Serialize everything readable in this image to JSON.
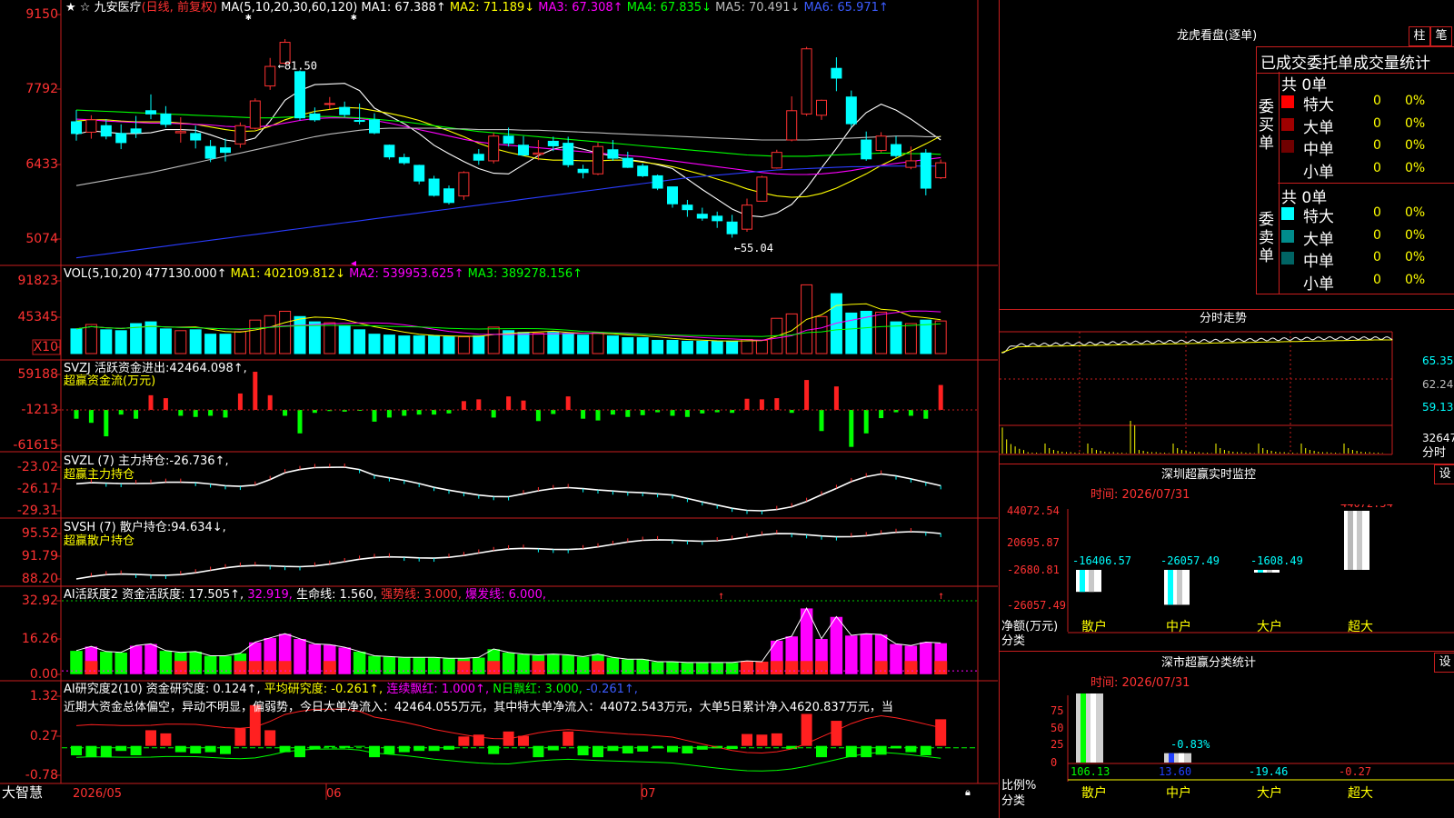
{
  "chart_header": {
    "symbol_name": "九安医疗",
    "period": "(日线, 前复权)",
    "ma_label": "MA(5,10,20,30,60,120)",
    "ma_values": [
      {
        "label": "MA1: 67.388↑",
        "color": "#ffffff"
      },
      {
        "label": "MA2: 71.189↓",
        "color": "#ffff00"
      },
      {
        "label": "MA3: 67.308↑",
        "color": "#ff00ff"
      },
      {
        "label": "MA4: 67.835↓",
        "color": "#00ff00"
      },
      {
        "label": "MA5: 70.491↓",
        "color": "#bcbcbc"
      },
      {
        "label": "MA6: 65.971↑",
        "color": "#3c5cff"
      }
    ],
    "price_high": "81.50",
    "price_low": "55.04"
  },
  "axes": {
    "main": [
      "9150",
      "7792",
      "6433",
      "5074"
    ],
    "vol": [
      "91823",
      "45345",
      "X10"
    ],
    "svzj": [
      "59188",
      "-1213",
      "-61615"
    ],
    "svzl": [
      "-23.02",
      "-26.17",
      "-29.31"
    ],
    "svsh": [
      "95.52",
      "91.79",
      "88.20"
    ],
    "ai2": [
      "32.92",
      "16.26",
      "0.00"
    ],
    "ai_res": [
      "1.32",
      "0.27",
      "-0.78"
    ]
  },
  "vol_header": {
    "name": "VOL(5,10,20)",
    "value": "477130.000↑",
    "ma1": "MA1: 402109.812↓",
    "ma2": "MA2: 539953.625↑",
    "ma3": "MA3: 389278.156↑"
  },
  "svzj_header": {
    "name": "SVZJ",
    "title": "活跃资金进出:",
    "value": "42464.098↑,",
    "sub": "超赢资金流(万元)"
  },
  "svzl_header": {
    "name": "SVZL (7)",
    "title": "主力持仓:",
    "value": "-26.736↑,",
    "sub": "超赢主力持仓"
  },
  "svsh_header": {
    "name": "SVSH (7)",
    "title": "散户持仓:",
    "value": "94.634↓,",
    "sub": "超赢散户持仓"
  },
  "ai2_header": {
    "text1": "AI活跃度2",
    "text2": "资金活跃度: 17.505↑,",
    "text3": "32.919,",
    "text4": "生命线: 1.560,",
    "text5": "强势线: 3.000,",
    "text6": "爆发线: 6.000,"
  },
  "ai_res_header": {
    "text1": "AI研究度2(10)",
    "text2": "资金研究度: 0.124↑,",
    "text3": "平均研究度: -0.261↑,",
    "text4": "连续飘红: 1.000↑,",
    "text5": "N日飘红: 3.000,",
    "text6": "-0.261↑,"
  },
  "commentary": "近期大资金总体偏空，异动不明显，偏弱势，今日大单净流入：42464.055万元，其中特大单净流入：44072.543万元，大单5日累计净入4620.837万元，当",
  "bottom_bar": {
    "brand": "大智慧",
    "dates": [
      "2026/05",
      "06",
      "07"
    ]
  },
  "right_panel": {
    "title": "龙虎看盘(逐单)",
    "btn_bar": "柱",
    "btn_pen": "笔",
    "tab": "已成交委托单成交量统计",
    "buy_side": "委买单",
    "sell_side": "委卖单",
    "buy_total": "共 0单",
    "sell_total": "共 0单",
    "buy_rows": [
      {
        "label": "特大",
        "count": "0",
        "pct": "0%",
        "color": "#ff0000"
      },
      {
        "label": "大单",
        "count": "0",
        "pct": "0%",
        "color": "#a00000"
      },
      {
        "label": "中单",
        "count": "0",
        "pct": "0%",
        "color": "#700000"
      },
      {
        "label": "小单",
        "count": "0",
        "pct": "0%",
        "color": "#000000"
      }
    ],
    "sell_rows": [
      {
        "label": "特大",
        "count": "0",
        "pct": "0%",
        "color": "#00ffff"
      },
      {
        "label": "大单",
        "count": "0",
        "pct": "0%",
        "color": "#008c8c"
      },
      {
        "label": "中单",
        "count": "0",
        "pct": "0%",
        "color": "#006464"
      },
      {
        "label": "小单",
        "count": "0",
        "pct": "0%",
        "color": "#000000"
      }
    ],
    "intraday": {
      "title": "分时走势",
      "axis": [
        "65.35",
        "62.24",
        "59.13",
        "32647"
      ],
      "unit": "分时"
    },
    "monitor": {
      "title": "深圳超赢实时监控",
      "set": "设",
      "time": "时间: 2026/07/31",
      "axis": [
        "44072.54",
        "20695.87",
        "-2680.81",
        "-26057.49"
      ],
      "unit1": "净额(万元)",
      "unit2": "分类",
      "cats": [
        "散户",
        "中户",
        "大户",
        "超大"
      ],
      "values": [
        "-16406.57",
        "-26057.49",
        "-1608.49",
        "44072.54"
      ]
    },
    "classify": {
      "title": "深市超赢分类统计",
      "set": "设",
      "time": "时间: 2026/07/31",
      "axis": [
        "75",
        "50",
        "25",
        "0"
      ],
      "unit1": "比例%",
      "unit2": "分类",
      "cats": [
        "散户",
        "中户",
        "大户",
        "超大"
      ],
      "values": [
        "106.13",
        "13.60",
        "-19.46",
        "-0.27"
      ],
      "mid_label": "-0.83%"
    }
  },
  "chart_data": [
    {
      "type": "candlestick",
      "title": "九安医疗 (日线, 前复权)",
      "ylim": [
        50.74,
        91.5
      ],
      "series_names": [
        "MA1",
        "MA2",
        "MA3",
        "MA4",
        "MA5",
        "MA6"
      ],
      "high_marker": 81.5,
      "low_marker": 55.04,
      "candles": [
        [
          72.8,
          74.6,
          69.9,
          71.0
        ],
        [
          71.2,
          73.8,
          70.2,
          73.1
        ],
        [
          72.2,
          73.2,
          70.1,
          70.6
        ],
        [
          71.0,
          72.4,
          68.6,
          69.6
        ],
        [
          71.7,
          73.7,
          70.3,
          71.1
        ],
        [
          74.5,
          77.0,
          73.2,
          74.0
        ],
        [
          74.0,
          75.2,
          71.9,
          72.4
        ],
        [
          71.1,
          73.5,
          69.6,
          71.3
        ],
        [
          71.0,
          72.2,
          68.7,
          70.0
        ],
        [
          69.0,
          70.0,
          66.6,
          67.2
        ],
        [
          68.8,
          70.2,
          66.7,
          68.1
        ],
        [
          69.4,
          72.7,
          68.8,
          72.2
        ],
        [
          71.8,
          76.4,
          71.6,
          76.0
        ],
        [
          78.3,
          82.6,
          77.7,
          81.3
        ],
        [
          81.8,
          85.5,
          81.6,
          85.0
        ],
        [
          80.5,
          80.7,
          73.0,
          73.4
        ],
        [
          74.0,
          75.0,
          72.8,
          73.1
        ],
        [
          75.6,
          76.6,
          74.7,
          75.6
        ],
        [
          75.0,
          75.9,
          73.5,
          73.9
        ],
        [
          73.0,
          75.6,
          72.4,
          72.9
        ],
        [
          73.1,
          74.1,
          70.9,
          71.1
        ],
        [
          69.2,
          69.3,
          67.0,
          67.4
        ],
        [
          67.3,
          67.9,
          66.2,
          66.5
        ],
        [
          66.1,
          66.2,
          63.2,
          63.7
        ],
        [
          64.0,
          64.5,
          61.3,
          61.5
        ],
        [
          62.5,
          63.0,
          60.1,
          60.4
        ],
        [
          61.4,
          65.2,
          60.8,
          65.0
        ],
        [
          67.8,
          68.6,
          66.2,
          66.9
        ],
        [
          66.8,
          71.1,
          66.4,
          70.6
        ],
        [
          70.6,
          71.9,
          69.0,
          69.5
        ],
        [
          69.2,
          70.6,
          67.5,
          67.7
        ],
        [
          67.8,
          70.0,
          66.9,
          68.0
        ],
        [
          69.8,
          70.5,
          68.3,
          69.1
        ],
        [
          69.5,
          70.5,
          65.8,
          66.2
        ],
        [
          65.5,
          66.2,
          64.1,
          65.0
        ],
        [
          64.8,
          69.6,
          64.6,
          69.0
        ],
        [
          68.5,
          70.0,
          66.8,
          67.2
        ],
        [
          67.2,
          68.2,
          65.7,
          65.8
        ],
        [
          66.0,
          66.4,
          64.3,
          64.5
        ],
        [
          64.5,
          64.7,
          62.3,
          62.6
        ],
        [
          62.8,
          62.8,
          59.6,
          60.2
        ],
        [
          60.0,
          60.8,
          58.2,
          59.3
        ],
        [
          58.6,
          59.6,
          57.6,
          58.0
        ],
        [
          58.3,
          59.0,
          56.5,
          57.6
        ],
        [
          57.4,
          58.5,
          55.0,
          55.6
        ],
        [
          56.3,
          61.0,
          55.9,
          60.0
        ],
        [
          60.6,
          64.5,
          60.6,
          64.3
        ],
        [
          65.7,
          68.5,
          65.6,
          68.1
        ],
        [
          70.0,
          76.7,
          69.8,
          74.5
        ],
        [
          74.0,
          84.3,
          73.7,
          84.0
        ],
        [
          73.8,
          76.2,
          73.1,
          76.1
        ],
        [
          81.0,
          82.7,
          77.5,
          79.5
        ],
        [
          76.6,
          77.6,
          72.0,
          72.5
        ],
        [
          70.0,
          71.3,
          66.8,
          67.1
        ],
        [
          68.4,
          71.2,
          68.1,
          70.6
        ],
        [
          69.3,
          70.6,
          67.3,
          67.6
        ],
        [
          65.8,
          69.0,
          65.5,
          66.8
        ],
        [
          68.0,
          68.6,
          61.5,
          62.6
        ],
        [
          64.2,
          67.0,
          64.0,
          66.5
        ]
      ],
      "moving_averages": {
        "MA1": [
          70.9,
          71.4,
          71.2,
          71.0,
          71.0,
          71.1,
          71.6,
          71.6,
          71.5,
          70.8,
          70.0,
          69.7,
          70.3,
          72.9,
          76.1,
          77.6,
          78.5,
          78.6,
          78.7,
          77.6,
          74.9,
          73.7,
          72.5,
          71.0,
          69.2,
          67.9,
          66.7,
          65.6,
          64.9,
          64.8,
          66.2,
          67.6,
          68.6,
          69.1,
          68.6,
          68.0,
          67.5,
          67.0,
          66.7,
          66.2,
          65.6,
          64.0,
          62.4,
          60.9,
          59.4,
          58.4,
          58.2,
          58.8,
          60.1,
          62.6,
          65.7,
          68.7,
          71.9,
          74.2,
          75.5,
          74.6,
          73.2,
          71.6,
          70.0
        ],
        "MA2": [
          72.9,
          73.1,
          73.1,
          72.9,
          72.8,
          72.8,
          72.8,
          72.6,
          72.4,
          72.0,
          71.6,
          71.3,
          71.4,
          72.1,
          73.1,
          73.8,
          74.4,
          74.7,
          75.0,
          74.9,
          74.5,
          74.1,
          73.6,
          73.0,
          72.2,
          71.4,
          70.5,
          69.5,
          68.7,
          68.1,
          67.6,
          67.1,
          66.9,
          66.9,
          66.8,
          66.8,
          66.9,
          66.9,
          66.6,
          66.3,
          65.9,
          65.3,
          64.7,
          64.0,
          63.3,
          62.5,
          61.9,
          61.4,
          61.2,
          61.3,
          61.8,
          62.6,
          63.7,
          64.8,
          66.1,
          67.2,
          68.3,
          69.4,
          70.6
        ],
        "MA3": [
          73.2,
          73.1,
          72.9,
          72.8,
          72.7,
          72.6,
          72.6,
          72.5,
          72.4,
          72.3,
          72.1,
          72.0,
          72.0,
          72.2,
          72.6,
          73.0,
          73.3,
          73.4,
          73.4,
          73.3,
          73.0,
          72.6,
          72.1,
          71.6,
          71.1,
          70.6,
          70.1,
          69.7,
          69.4,
          69.2,
          69.0,
          68.8,
          68.6,
          68.4,
          68.2,
          68.0,
          67.8,
          67.6,
          67.4,
          67.1,
          66.8,
          66.5,
          66.2,
          65.9,
          65.6,
          65.3,
          65.0,
          64.8,
          64.7,
          64.7,
          64.8,
          65.0,
          65.3,
          65.7,
          66.1,
          66.4,
          66.7,
          67.0,
          67.3
        ],
        "MA4": [
          74.6,
          74.5,
          74.4,
          74.3,
          74.2,
          74.1,
          74.0,
          73.9,
          73.8,
          73.7,
          73.6,
          73.5,
          73.4,
          73.4,
          73.5,
          73.6,
          73.6,
          73.6,
          73.5,
          73.4,
          73.2,
          73.0,
          72.8,
          72.5,
          72.2,
          71.9,
          71.6,
          71.3,
          71.1,
          70.9,
          70.7,
          70.5,
          70.3,
          70.1,
          69.9,
          69.7,
          69.5,
          69.3,
          69.1,
          68.9,
          68.7,
          68.5,
          68.3,
          68.1,
          67.9,
          67.7,
          67.6,
          67.5,
          67.5,
          67.5,
          67.6,
          67.7,
          67.8,
          67.9,
          68.0,
          68.0,
          67.9,
          67.9,
          67.8
        ],
        "MA5": [
          63.0,
          63.4,
          63.8,
          64.2,
          64.6,
          65.0,
          65.5,
          66.0,
          66.5,
          67.0,
          67.5,
          68.0,
          68.5,
          69.0,
          69.5,
          70.0,
          70.5,
          70.9,
          71.2,
          71.5,
          71.7,
          71.8,
          71.8,
          71.8,
          71.8,
          71.7,
          71.7,
          71.6,
          71.6,
          71.6,
          71.5,
          71.5,
          71.4,
          71.3,
          71.2,
          71.1,
          71.0,
          70.9,
          70.8,
          70.7,
          70.6,
          70.5,
          70.4,
          70.3,
          70.2,
          70.1,
          70.0,
          70.0,
          70.0,
          70.0,
          70.1,
          70.2,
          70.3,
          70.4,
          70.5,
          70.6,
          70.6,
          70.5,
          70.5
        ],
        "MA6": [
          51.9,
          52.2,
          52.5,
          52.8,
          53.1,
          53.4,
          53.7,
          54.0,
          54.3,
          54.6,
          54.9,
          55.2,
          55.5,
          55.8,
          56.1,
          56.4,
          56.7,
          57.0,
          57.3,
          57.6,
          57.9,
          58.2,
          58.5,
          58.8,
          59.1,
          59.4,
          59.7,
          60.0,
          60.3,
          60.6,
          60.9,
          61.2,
          61.5,
          61.8,
          62.1,
          62.4,
          62.7,
          63.0,
          63.3,
          63.6,
          63.9,
          64.2,
          64.4,
          64.6,
          64.8,
          65.0,
          65.2,
          65.4,
          65.5,
          65.6,
          65.7,
          65.8,
          65.9,
          65.9,
          66.0,
          66.0,
          66.0,
          66.0,
          66.0
        ]
      },
      "volume_x10": [
        28000,
        33000,
        27000,
        26000,
        34000,
        36000,
        28000,
        26000,
        27000,
        22000,
        22000,
        25000,
        38000,
        43000,
        48000,
        42000,
        36000,
        35000,
        32000,
        27000,
        22000,
        21000,
        20000,
        20000,
        20000,
        19000,
        19000,
        20000,
        30000,
        26000,
        24000,
        23000,
        24000,
        23000,
        21000,
        24000,
        20000,
        18000,
        18000,
        15000,
        15000,
        14000,
        14000,
        14000,
        14000,
        16000,
        15000,
        40000,
        45000,
        78000,
        42000,
        68000,
        46000,
        48000,
        47000,
        36000,
        34000,
        38000,
        37000
      ],
      "svzj": [
        -15000,
        -22000,
        -45000,
        -8000,
        -15000,
        25000,
        20000,
        -10000,
        -12000,
        -10000,
        -13000,
        28000,
        65000,
        25000,
        -10000,
        -40000,
        -5000,
        -2000,
        -3000,
        -1000,
        -20000,
        -13000,
        -10000,
        -8000,
        -8000,
        -6000,
        15000,
        18000,
        -13000,
        23000,
        16000,
        -19000,
        -7000,
        23000,
        -15000,
        -18000,
        -8000,
        -12000,
        -9000,
        -4000,
        -10000,
        -12000,
        -6000,
        -4000,
        -5000,
        19000,
        18000,
        20000,
        -5000,
        51000,
        -36000,
        40000,
        -63000,
        -40000,
        -14000,
        -4000,
        -10000,
        -15000,
        42464
      ]
    }
  ]
}
